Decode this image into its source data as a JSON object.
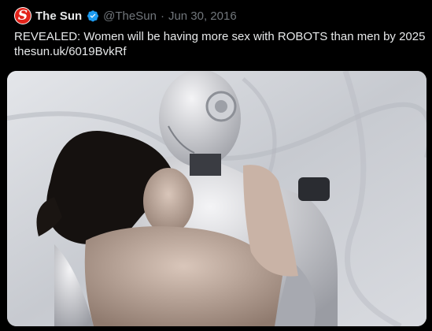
{
  "tweet": {
    "display_name": "The Sun",
    "handle": "@TheSun",
    "separator": "·",
    "date": "Jun 30, 2016",
    "text_line1": "REVEALED: Women will be having more sex with ROBOTS than men by 2025",
    "link": "thesun.uk/6019BvkRf",
    "avatar_letter": "S"
  },
  "icons": {
    "avatar": "the-sun-logo",
    "verified": "verified-badge-icon"
  },
  "colors": {
    "background": "#000000",
    "text": "#e7e9ea",
    "muted": "#71767b",
    "verified": "#1d9bf0",
    "brand": "#e2231a"
  }
}
